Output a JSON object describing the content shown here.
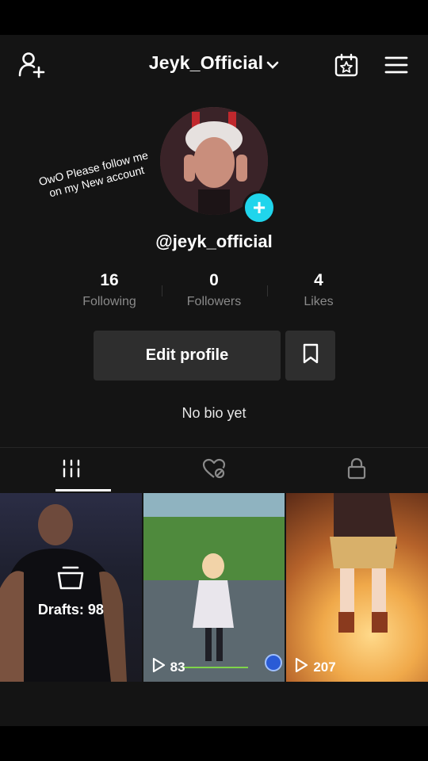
{
  "header": {
    "title": "Jeyk_Official",
    "add_user_icon": "person-plus-icon",
    "calendar_icon": "calendar-star-icon",
    "menu_icon": "hamburger-menu-icon"
  },
  "overlay_caption": "OwO Please follow me on my New account",
  "profile": {
    "username": "@jeyk_official",
    "accent_color": "#20d5ec"
  },
  "stats": [
    {
      "value": "16",
      "label": "Following"
    },
    {
      "value": "0",
      "label": "Followers"
    },
    {
      "value": "4",
      "label": "Likes"
    }
  ],
  "actions": {
    "edit_profile": "Edit profile",
    "bookmark_icon": "bookmark-icon"
  },
  "bio": "No bio yet",
  "tabs": [
    {
      "icon": "grid-icon",
      "active": true
    },
    {
      "icon": "liked-heart-icon",
      "active": false
    },
    {
      "icon": "lock-icon",
      "active": false
    }
  ],
  "videos": [
    {
      "type": "drafts",
      "label": "Drafts: 98"
    },
    {
      "type": "video",
      "views": "83"
    },
    {
      "type": "video",
      "views": "207"
    }
  ]
}
